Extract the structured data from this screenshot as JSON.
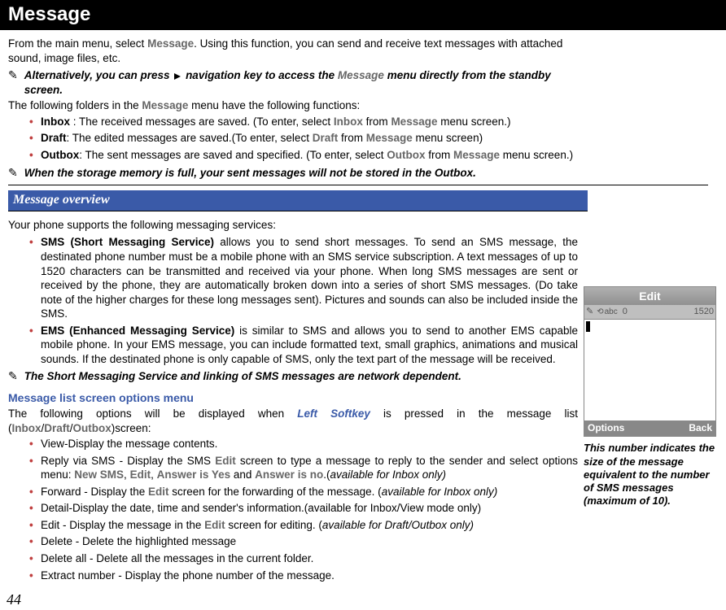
{
  "header": {
    "title": "Message"
  },
  "intro": {
    "prefix": "From the main menu, select ",
    "menu": "Message",
    "suffix": ". Using this function, you can send and receive text messages with attached sound, image files, etc."
  },
  "alt_note": {
    "p1": "Alternatively, you can press ",
    "p2": " navigation key to access the ",
    "menu": "Message",
    "p3": " menu directly from the standby screen."
  },
  "folders_intro": {
    "prefix": "The following folders in the ",
    "menu": "Message",
    "suffix": " menu have the following functions:"
  },
  "folders": [
    {
      "name": "Inbox",
      "sep": " : ",
      "desc": "The received messages are saved. (To enter, select ",
      "sel": "Inbox",
      "mid": " from ",
      "menu": "Message",
      "end": " menu screen.)"
    },
    {
      "name": "Draft",
      "sep": ": ",
      "desc": "The edited messages are saved.(To enter, select ",
      "sel": "Draft",
      "mid": "  from ",
      "menu": "Message",
      "end": " menu screen)"
    },
    {
      "name": "Outbox",
      "sep": ": ",
      "desc": "The sent messages are saved and specified. (To enter, select ",
      "sel": "Outbox",
      "mid": " from ",
      "menu": "Message",
      "end": " menu screen.)"
    }
  ],
  "storage_note": "When the storage memory is full, your sent messages will not be stored in the Outbox.",
  "section_title": "Message overview",
  "overview_intro": "Your phone supports the following messaging services:",
  "services": [
    {
      "name": "SMS (Short Messaging Service)",
      "text": " allows you to send short messages. To send an SMS message, the destinated phone number must be a mobile phone with an SMS service subscription. A text messages of up to 1520 characters can be transmitted and received via your phone. When long SMS messages are sent or received by the phone, they are automatically broken down into a series of short SMS messages.  (Do take note of the higher charges for these long messages sent).  Pictures and sounds can also be included inside the SMS."
    },
    {
      "name": "EMS (Enhanced Messaging Service)",
      "text": " is similar to SMS and allows you to send to another EMS capable mobile phone. In your EMS message, you can include formatted text, small graphics, animations and musical sounds. If the destinated phone is only capable of SMS, only the text part of the message will be received."
    }
  ],
  "network_note": "The Short Messaging Service and linking of SMS messages are network dependent.",
  "list_menu": {
    "heading": "Message list screen options menu",
    "p1": "The following options will be displayed when ",
    "softkey": "Left Softkey",
    "p2": " is pressed in the message list (",
    "i1": "Inbox",
    "i2": "Draft",
    "i3": "Outbox",
    "p3": ")screen:"
  },
  "options": [
    {
      "text": "View-Display the message contents."
    },
    {
      "prefix": "Reply via SMS - Display the SMS ",
      "g1": "Edit",
      "mid": " screen to type a message to reply to the sender and select options menu: ",
      "g2": "New SMS",
      "g3": "Edit",
      "g4": "Answer is Yes",
      "g5": "Answer is no",
      "suffix": ".(",
      "ital": "available for Inbox only)",
      "comma1": ", ",
      "comma2": ", ",
      "and": " and "
    },
    {
      "prefix": "Forward  - Display the ",
      "g1": "Edit",
      "mid": " screen for the forwarding of the message. (",
      "ital": "available for Inbox only)"
    },
    {
      "text": "Detail-Display the date, time and sender's information.(available for Inbox/View mode only)"
    },
    {
      "prefix": "Edit - Display the message in the ",
      "g1": "Edit",
      "mid": " screen for editing. (",
      "ital": "available for Draft/Outbox only)"
    },
    {
      "text": "Delete - Delete the highlighted message"
    },
    {
      "text": "Delete all - Delete all the messages in the current folder."
    },
    {
      "text": "Extract number - Display the phone number of the message."
    }
  ],
  "phone": {
    "title": "Edit",
    "mode": "abc",
    "count": "0",
    "limit": "1520",
    "left_soft": "Options",
    "right_soft": "Back",
    "caption": "This number indicates the size of the message equivalent to the number of SMS messages (maximum of 10)."
  },
  "page_number": "44"
}
